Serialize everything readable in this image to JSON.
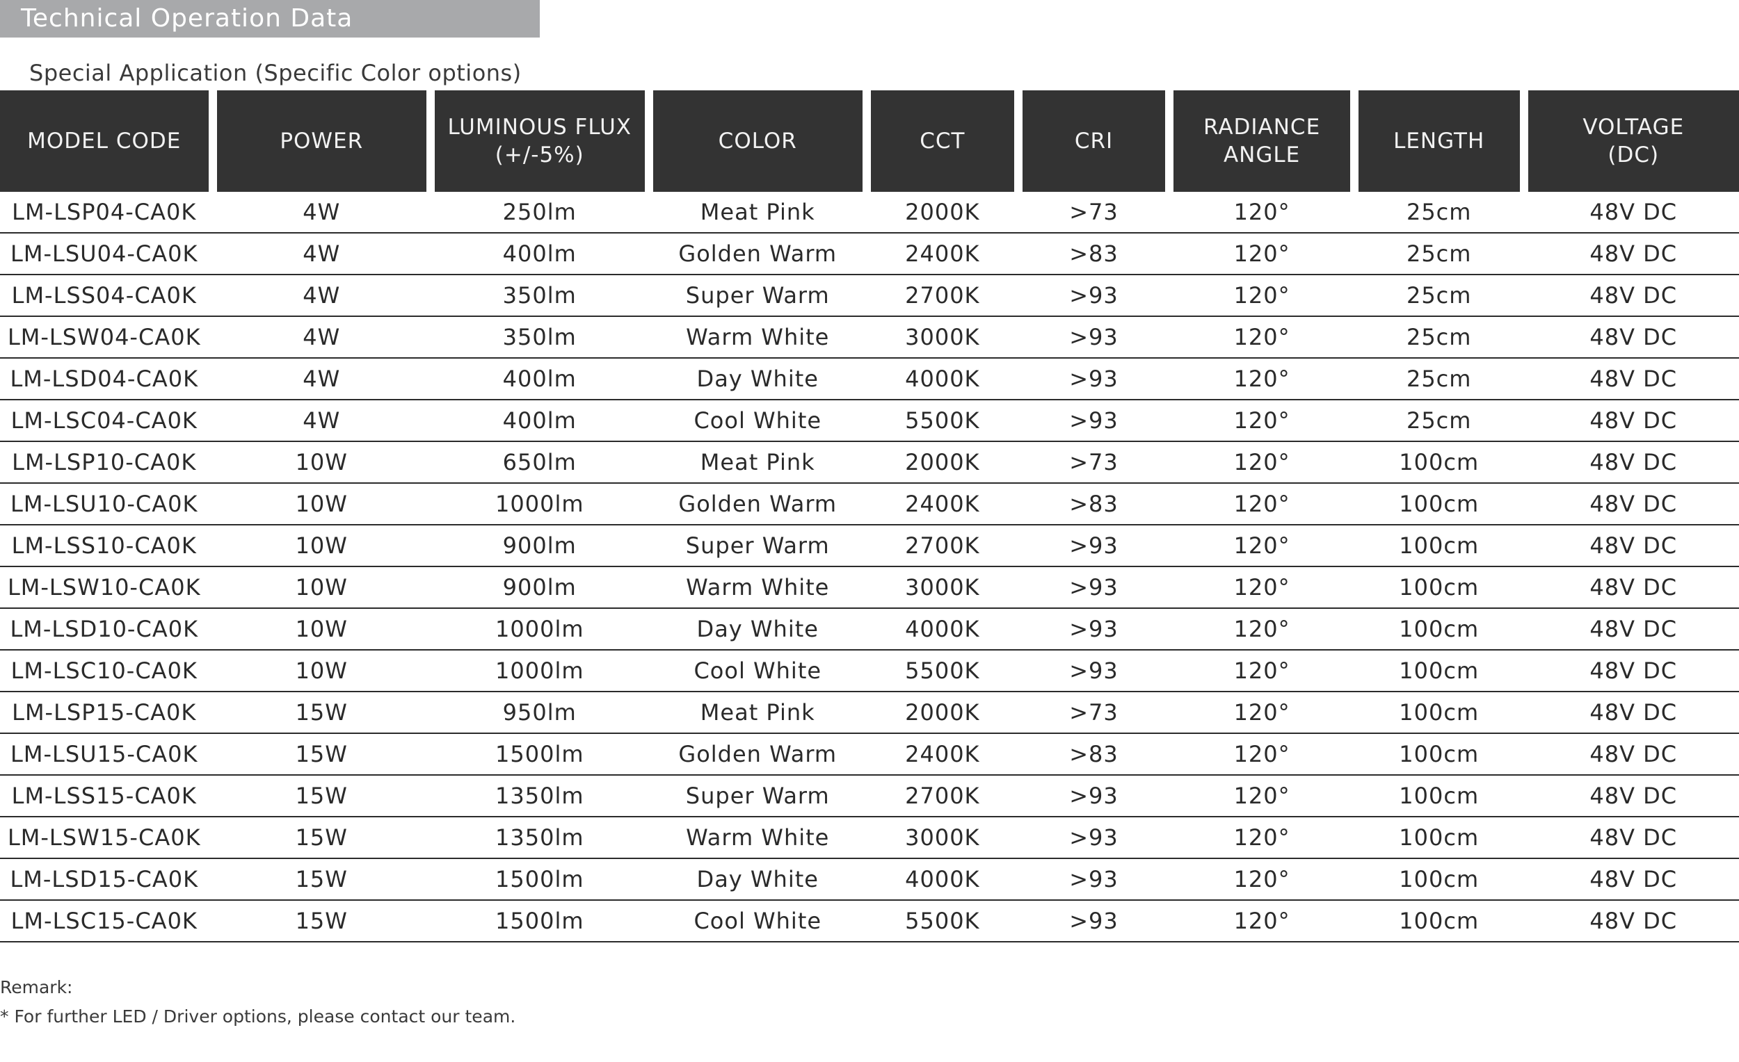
{
  "title": "Technical Operation Data",
  "subtitle": "Special Application (Specific Color options)",
  "table": {
    "headers": [
      "MODEL CODE",
      "POWER",
      "LUMINOUS FLUX\n(+/-5%)",
      "COLOR",
      "CCT",
      "CRI",
      "RADIANCE\nANGLE",
      "LENGTH",
      "VOLTAGE\n(DC)"
    ],
    "rows": [
      [
        "LM-LSP04-CA0K",
        "4W",
        "250lm",
        "Meat Pink",
        "2000K",
        ">73",
        "120°",
        "25cm",
        "48V DC"
      ],
      [
        "LM-LSU04-CA0K",
        "4W",
        "400lm",
        "Golden Warm",
        "2400K",
        ">83",
        "120°",
        "25cm",
        "48V DC"
      ],
      [
        "LM-LSS04-CA0K",
        "4W",
        "350lm",
        "Super Warm",
        "2700K",
        ">93",
        "120°",
        "25cm",
        "48V DC"
      ],
      [
        "LM-LSW04-CA0K",
        "4W",
        "350lm",
        "Warm White",
        "3000K",
        ">93",
        "120°",
        "25cm",
        "48V DC"
      ],
      [
        "LM-LSD04-CA0K",
        "4W",
        "400lm",
        "Day White",
        "4000K",
        ">93",
        "120°",
        "25cm",
        "48V DC"
      ],
      [
        "LM-LSC04-CA0K",
        "4W",
        "400lm",
        "Cool White",
        "5500K",
        ">93",
        "120°",
        "25cm",
        "48V DC"
      ],
      [
        "LM-LSP10-CA0K",
        "10W",
        "650lm",
        "Meat Pink",
        "2000K",
        ">73",
        "120°",
        "100cm",
        "48V DC"
      ],
      [
        "LM-LSU10-CA0K",
        "10W",
        "1000lm",
        "Golden Warm",
        "2400K",
        ">83",
        "120°",
        "100cm",
        "48V DC"
      ],
      [
        "LM-LSS10-CA0K",
        "10W",
        "900lm",
        "Super Warm",
        "2700K",
        ">93",
        "120°",
        "100cm",
        "48V DC"
      ],
      [
        "LM-LSW10-CA0K",
        "10W",
        "900lm",
        "Warm White",
        "3000K",
        ">93",
        "120°",
        "100cm",
        "48V DC"
      ],
      [
        "LM-LSD10-CA0K",
        "10W",
        "1000lm",
        "Day White",
        "4000K",
        ">93",
        "120°",
        "100cm",
        "48V DC"
      ],
      [
        "LM-LSC10-CA0K",
        "10W",
        "1000lm",
        "Cool White",
        "5500K",
        ">93",
        "120°",
        "100cm",
        "48V DC"
      ],
      [
        "LM-LSP15-CA0K",
        "15W",
        "950lm",
        "Meat Pink",
        "2000K",
        ">73",
        "120°",
        "100cm",
        "48V DC"
      ],
      [
        "LM-LSU15-CA0K",
        "15W",
        "1500lm",
        "Golden Warm",
        "2400K",
        ">83",
        "120°",
        "100cm",
        "48V DC"
      ],
      [
        "LM-LSS15-CA0K",
        "15W",
        "1350lm",
        "Super Warm",
        "2700K",
        ">93",
        "120°",
        "100cm",
        "48V DC"
      ],
      [
        "LM-LSW15-CA0K",
        "15W",
        "1350lm",
        "Warm White",
        "3000K",
        ">93",
        "120°",
        "100cm",
        "48V DC"
      ],
      [
        "LM-LSD15-CA0K",
        "15W",
        "1500lm",
        "Day White",
        "4000K",
        ">93",
        "120°",
        "100cm",
        "48V DC"
      ],
      [
        "LM-LSC15-CA0K",
        "15W",
        "1500lm",
        "Cool White",
        "5500K",
        ">93",
        "120°",
        "100cm",
        "48V DC"
      ]
    ]
  },
  "remark": {
    "label": "Remark:",
    "note": "* For further LED / Driver options, please contact our team."
  },
  "colors": {
    "title_bar": "#a8a9ab",
    "header_bg": "#333333",
    "header_text": "#f2f2f2",
    "row_line": "#2b2b2b"
  }
}
